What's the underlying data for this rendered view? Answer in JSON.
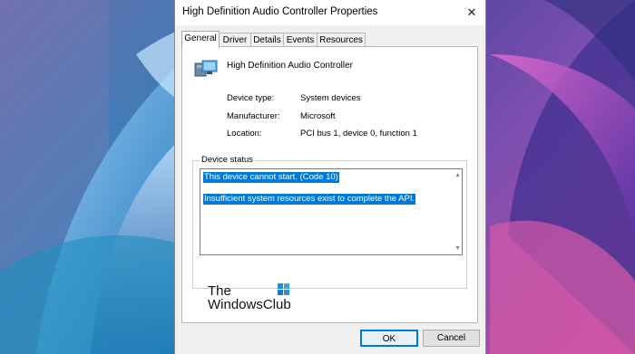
{
  "window": {
    "title": "High Definition Audio Controller Properties",
    "close_glyph": "✕"
  },
  "tabs": [
    {
      "label": "General",
      "active": true
    },
    {
      "label": "Driver",
      "active": false
    },
    {
      "label": "Details",
      "active": false
    },
    {
      "label": "Events",
      "active": false
    },
    {
      "label": "Resources",
      "active": false
    }
  ],
  "device": {
    "icon": "audio-controller-icon",
    "name": "High Definition Audio Controller"
  },
  "properties": [
    {
      "label": "Device type:",
      "value": "System devices"
    },
    {
      "label": "Manufacturer:",
      "value": "Microsoft"
    },
    {
      "label": "Location:",
      "value": "PCI bus 1, device 0, function 1"
    }
  ],
  "device_status": {
    "label": "Device status",
    "lines": [
      "This device cannot start. (Code 10)",
      "Insufficient system resources exist to complete the API."
    ],
    "selection_color": "#0078d7"
  },
  "watermark": {
    "line1": "The",
    "line2": "WindowsClub"
  },
  "buttons": {
    "ok_label": "OK",
    "cancel_label": "Cancel",
    "accent": "#0078d7"
  }
}
